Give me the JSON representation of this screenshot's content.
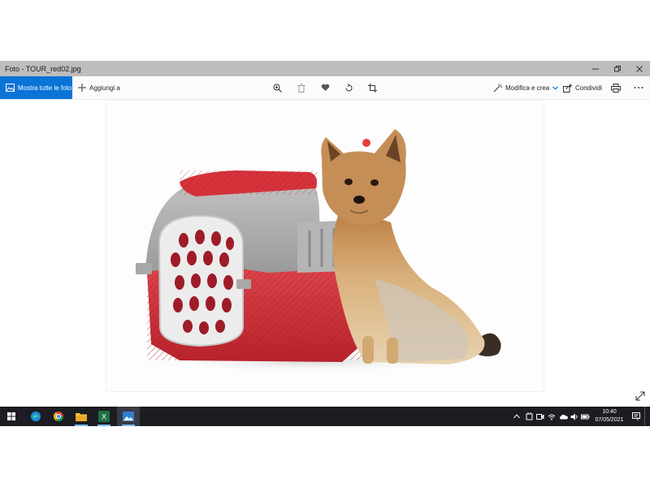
{
  "window": {
    "title": "Foto - TOUR_red02.jpg"
  },
  "toolbar": {
    "show_all_label": "Mostra tutte le foto",
    "add_to_label": "Aggiungi a",
    "edit_create_label": "Modifica e crea",
    "share_label": "Condividi"
  },
  "photo": {
    "subject": "Yorkshire terrier sitting next to a red and grey pet carrier",
    "colors": {
      "carrier_red": "#d6323b",
      "carrier_grey": "#a7a7a7",
      "dog_tan": "#c99660"
    }
  },
  "taskbar": {
    "apps": [
      "start",
      "edge",
      "chrome",
      "file-explorer",
      "excel",
      "photos"
    ],
    "time": "10:40",
    "date": "07/05/2021"
  },
  "theme": {
    "accent": "#0a74d6",
    "titlebar_bg": "#bdbdbd",
    "taskbar_bg": "#1c1c22"
  }
}
